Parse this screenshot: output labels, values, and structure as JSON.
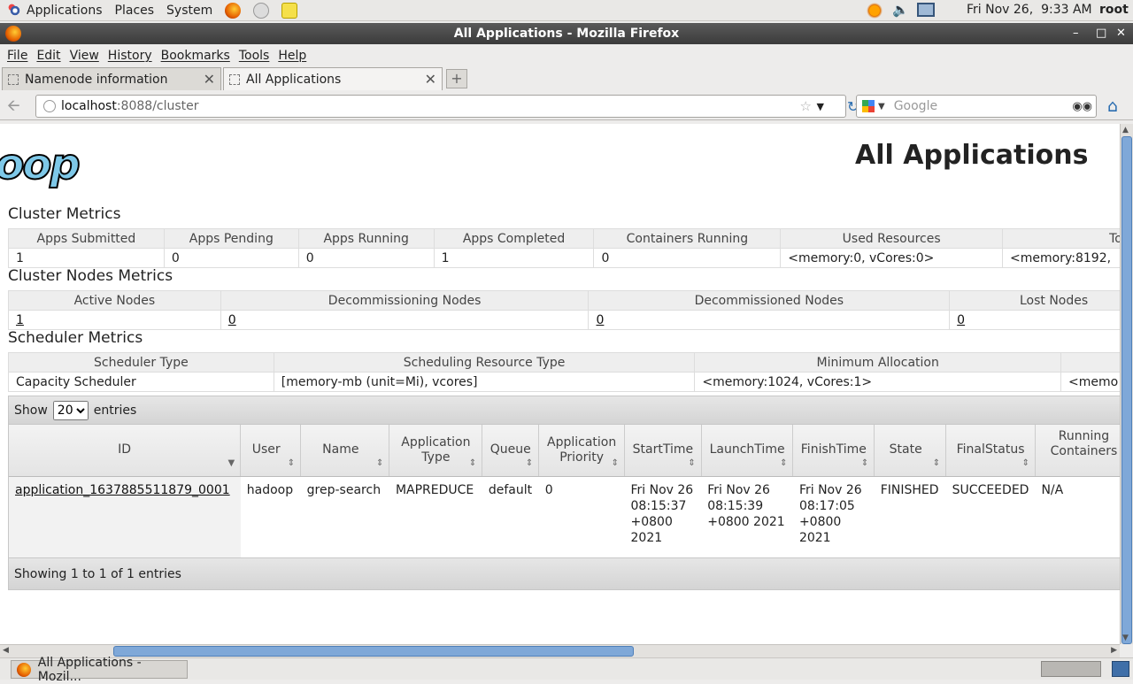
{
  "topbar": {
    "menus": [
      "Applications",
      "Places",
      "System"
    ],
    "datetime": "Fri Nov 26,  9:33 AM",
    "user": "root"
  },
  "window": {
    "title": "All Applications - Mozilla Firefox"
  },
  "menubar": [
    "File",
    "Edit",
    "View",
    "History",
    "Bookmarks",
    "Tools",
    "Help"
  ],
  "tabs": [
    {
      "label": "Namenode information"
    },
    {
      "label": "All Applications"
    }
  ],
  "navbar": {
    "url_host": "localhost",
    "url_path": ":8088/cluster",
    "search_placeholder": "Google"
  },
  "page": {
    "logo_text": "loop",
    "title": "All Applications"
  },
  "cluster_metrics": {
    "title": "Cluster Metrics",
    "headers": [
      "Apps Submitted",
      "Apps Pending",
      "Apps Running",
      "Apps Completed",
      "Containers Running",
      "Used Resources",
      "Total R"
    ],
    "values": [
      "1",
      "0",
      "0",
      "1",
      "0",
      "<memory:0, vCores:0>",
      "<memory:8192, "
    ]
  },
  "cluster_nodes_metrics": {
    "title": "Cluster Nodes Metrics",
    "headers": [
      "Active Nodes",
      "Decommissioning Nodes",
      "Decommissioned Nodes",
      "Lost Nodes"
    ],
    "values": [
      "1",
      "0",
      "0",
      "0"
    ]
  },
  "scheduler_metrics": {
    "title": "Scheduler Metrics",
    "headers": [
      "Scheduler Type",
      "Scheduling Resource Type",
      "Minimum Allocation",
      ""
    ],
    "values": [
      "Capacity Scheduler",
      "[memory-mb (unit=Mi), vcores]",
      "<memory:1024, vCores:1>",
      "<memo"
    ]
  },
  "apps": {
    "show_label": "Show",
    "entries_label": "entries",
    "page_size": "20",
    "headers": [
      "ID",
      "User",
      "Name",
      "Application Type",
      "Queue",
      "Application Priority",
      "StartTime",
      "LaunchTime",
      "FinishTime",
      "State",
      "FinalStatus",
      "Running Containers"
    ],
    "rows": [
      {
        "id": "application_1637885511879_0001",
        "user": "hadoop",
        "name": "grep-search",
        "type": "MAPREDUCE",
        "queue": "default",
        "priority": "0",
        "start": "Fri Nov 26 08:15:37 +0800 2021",
        "launch": "Fri Nov 26 08:15:39 +0800 2021",
        "finish": "Fri Nov 26 08:17:05 +0800 2021",
        "state": "FINISHED",
        "final_status": "SUCCEEDED",
        "running_containers": "N/A"
      }
    ],
    "footer": "Showing 1 to 1 of 1 entries"
  },
  "taskbar": {
    "window_label": "All Applications - Mozil..."
  }
}
